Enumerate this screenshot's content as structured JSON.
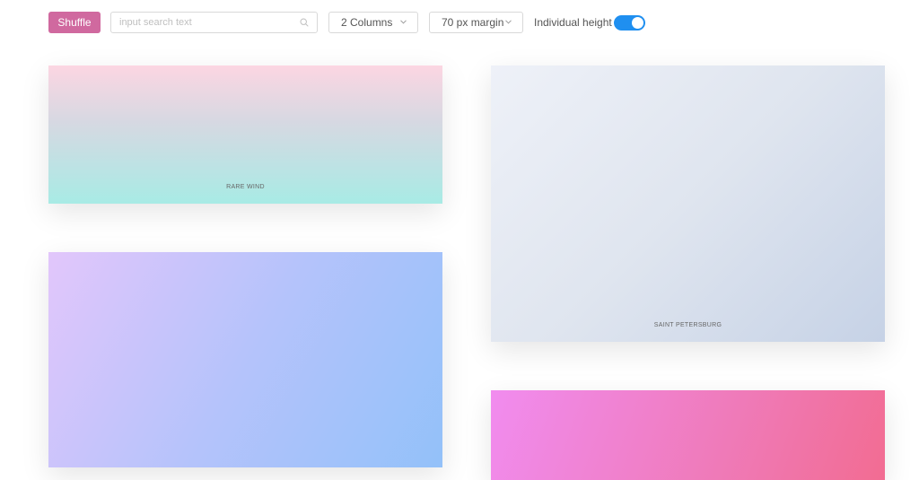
{
  "toolbar": {
    "shuffle_label": "Shuffle",
    "search": {
      "value": "",
      "placeholder": "input search text",
      "icon": "search-icon"
    },
    "columns_select": {
      "selected": "2 Columns",
      "icon": "chevron-down-icon"
    },
    "margin_select": {
      "selected": "70 px margin",
      "icon": "chevron-down-icon"
    },
    "individual_height": {
      "label": "Individual height",
      "enabled": true
    }
  },
  "colors": {
    "accent": "#d0699f",
    "toggle_on": "#1f8ff0"
  },
  "cards": [
    {
      "title": "RARE WIND"
    },
    {
      "title": "SAINT PETERSBURG"
    },
    {
      "title": ""
    },
    {
      "title": ""
    }
  ]
}
